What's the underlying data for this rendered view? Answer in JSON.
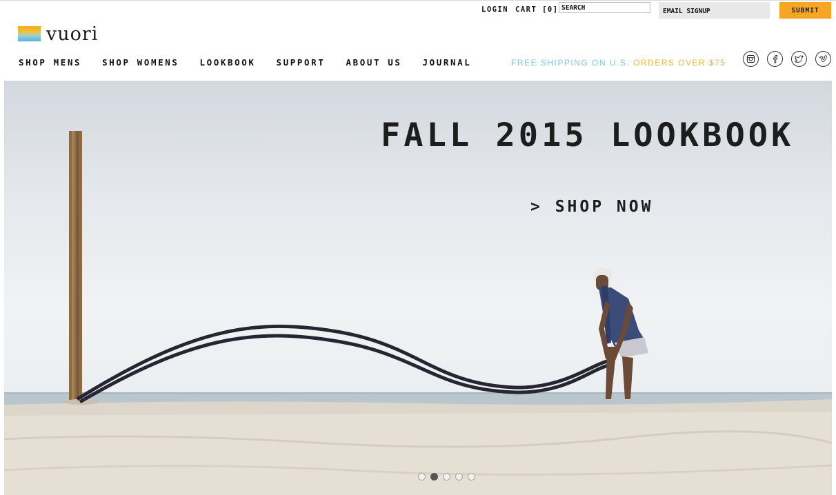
{
  "header": {
    "logo_text": "vuori",
    "login_label": "LOGIN",
    "cart_label": "CART [0]",
    "search_placeholder": "SEARCH",
    "email_placeholder": "EMAIL SIGNUP",
    "submit_label": "SUBMIT"
  },
  "nav": {
    "items": [
      {
        "label": "SHOP MENS"
      },
      {
        "label": "SHOP WOMENS"
      },
      {
        "label": "LOOKBOOK"
      },
      {
        "label": "SUPPORT"
      },
      {
        "label": "ABOUT US"
      },
      {
        "label": "JOURNAL"
      }
    ],
    "shipping_part1": "FREE SHIPPING ON U.S. ",
    "shipping_part2": "ORDERS OVER $75",
    "social": [
      "instagram-icon",
      "facebook-icon",
      "twitter-icon",
      "vimeo-icon"
    ]
  },
  "hero": {
    "title": "FALL 2015 LOOKBOOK",
    "cta": "> SHOP NOW",
    "slides_total": 5,
    "active_slide": 2
  },
  "colors": {
    "accent": "#f6a623",
    "shipping_blue": "#7ec8df",
    "shipping_gold": "#e8ba3c"
  }
}
